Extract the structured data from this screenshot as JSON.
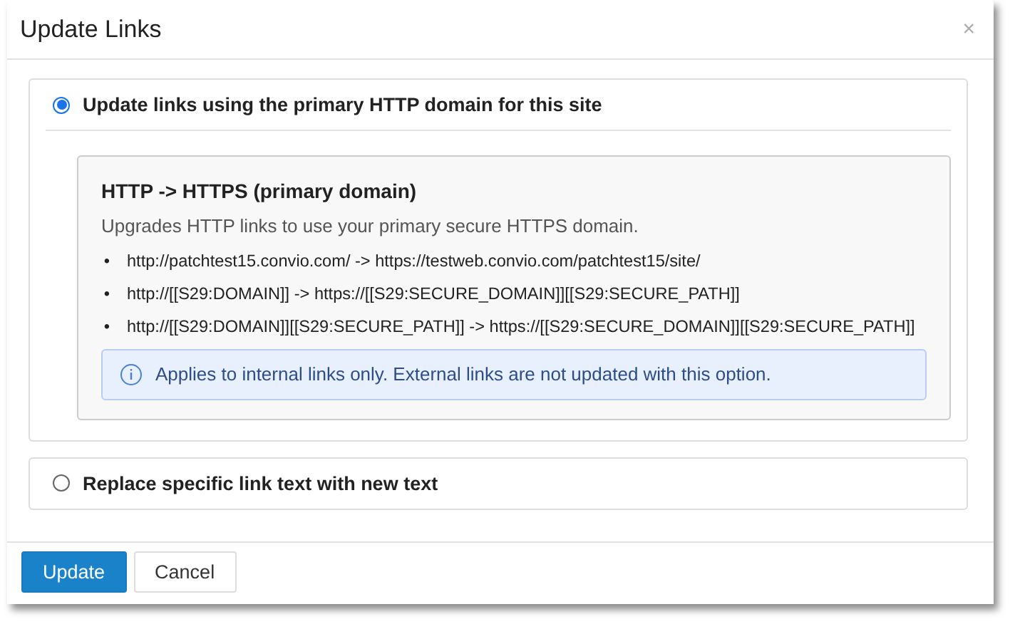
{
  "window": {
    "title": "Update Links",
    "close": "×"
  },
  "options": [
    {
      "label": "Update links using the primary HTTP domain for this site",
      "selected": true,
      "details": {
        "title": "HTTP -> HTTPS (primary domain)",
        "description": "Upgrades HTTP links to use your primary secure HTTPS domain.",
        "rules": [
          {
            "marker": "•",
            "text": "http://patchtest15.convio.com/ -> https://testweb.convio.com/patchtest15/site/"
          },
          {
            "marker": "•",
            "text": "http://[[S29:DOMAIN]] -> https://[[S29:SECURE_DOMAIN]][[S29:SECURE_PATH]]"
          },
          {
            "marker": "•",
            "text": "http://[[S29:DOMAIN]][[S29:SECURE_PATH]] -> https://[[S29:SECURE_DOMAIN]][[S29:SECURE_PATH]]"
          }
        ],
        "note": "Applies to internal links only. External links are not updated with this option."
      }
    },
    {
      "label": "Replace specific link text with new text",
      "selected": false
    }
  ],
  "buttons": [
    {
      "label": "Update",
      "kind": "primary"
    },
    {
      "label": "Cancel",
      "kind": "default"
    }
  ]
}
